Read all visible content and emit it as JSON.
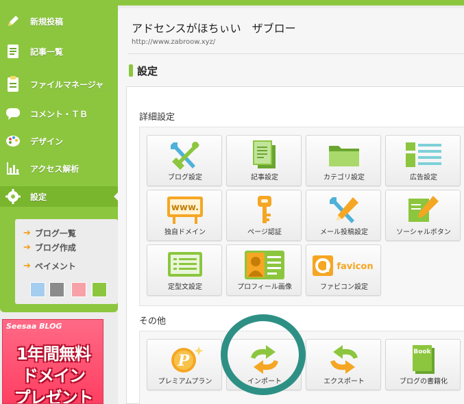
{
  "sidebar": {
    "items": [
      {
        "label": "新規投稿",
        "icon": "pencil-icon"
      },
      {
        "label": "記事一覧",
        "icon": "article-list-icon"
      },
      {
        "label": "ファイルマネージャ",
        "icon": "clipboard-icon"
      },
      {
        "label": "コメント・ＴＢ",
        "icon": "comment-icon"
      },
      {
        "label": "デザイン",
        "icon": "palette-icon"
      },
      {
        "label": "アクセス解析",
        "icon": "bar-chart-icon"
      },
      {
        "label": "設定",
        "icon": "gear-icon"
      }
    ],
    "sub_items": [
      "ブログ一覧",
      "ブログ作成",
      "ペイメント"
    ],
    "swatches": [
      "#a5cdef",
      "#8b8b8b",
      "#f7a1a8",
      "#8cc63f"
    ]
  },
  "ad": {
    "brand": "Seesaa BLOG",
    "lines": [
      "1年間無料",
      "ドメイン",
      "プレゼント"
    ]
  },
  "header": {
    "blog_title": "アドセンスがほちぃい　ザブロー",
    "blog_url": "http://www.zabroow.xyz/",
    "section_title": "設定"
  },
  "details": {
    "title": "詳細設定",
    "tiles": [
      {
        "label": "ブログ設定",
        "icon": "tools-icon"
      },
      {
        "label": "記事設定",
        "icon": "document-icon"
      },
      {
        "label": "カテゴリ設定",
        "icon": "folder-icon"
      },
      {
        "label": "広告設定",
        "icon": "layout-icon"
      },
      {
        "label": "独自ドメイン",
        "icon": "www-sign-icon",
        "icon_text": "www."
      },
      {
        "label": "ページ認証",
        "icon": "key-icon"
      },
      {
        "label": "メール投稿設定",
        "icon": "mail-post-icon"
      },
      {
        "label": "ソーシャルボタン",
        "icon": "social-post-icon"
      },
      {
        "label": "定型文設定",
        "icon": "template-icon"
      },
      {
        "label": "プロフィール画像",
        "icon": "profile-icon"
      },
      {
        "label": "ファビコン設定",
        "icon": "favicon-icon",
        "icon_text": "favicon"
      }
    ]
  },
  "other": {
    "title": "その他",
    "tiles": [
      {
        "label": "プレミアムプラン",
        "icon": "premium-coin-icon",
        "icon_text": "P"
      },
      {
        "label": "インポート",
        "icon": "import-arrows-icon"
      },
      {
        "label": "エクスポート",
        "icon": "export-arrows-icon"
      },
      {
        "label": "ブログの書籍化",
        "icon": "book-icon",
        "icon_text": "Book"
      }
    ]
  },
  "colors": {
    "accent": "#8cc63f",
    "highlight_ring": "#2e9085",
    "ad_background": "#ff4a6a"
  }
}
